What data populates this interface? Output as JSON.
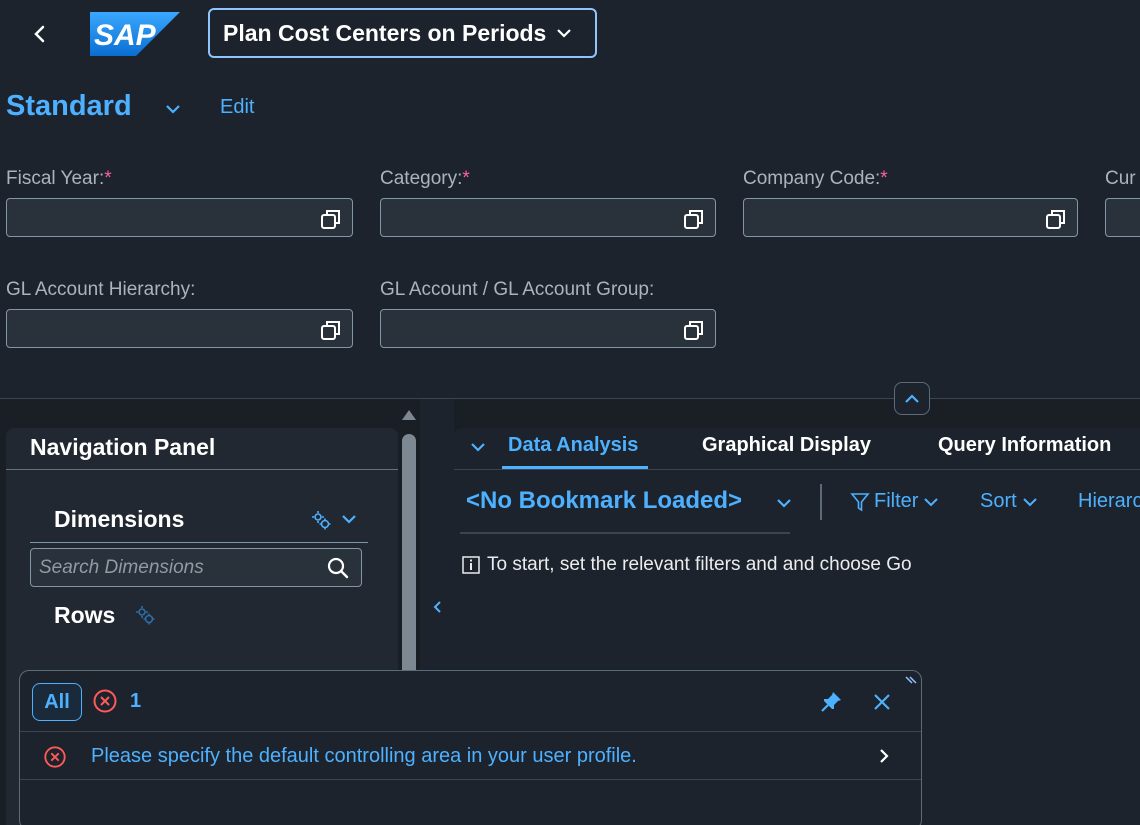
{
  "shell": {
    "logo_text": "SAP",
    "app_title": "Plan Cost Centers on Periods"
  },
  "variant": {
    "name": "Standard",
    "edit_label": "Edit"
  },
  "filters": {
    "fiscal_year": {
      "label": "Fiscal Year:",
      "required": "*",
      "value": ""
    },
    "category": {
      "label": "Category:",
      "required": "*",
      "value": ""
    },
    "company_code": {
      "label": "Company Code:",
      "required": "*",
      "value": ""
    },
    "currency_partial": {
      "label": "Cur"
    },
    "gl_account_hierarchy": {
      "label": "GL Account Hierarchy:",
      "value": ""
    },
    "gl_account_group": {
      "label": "GL Account / GL Account Group:",
      "value": ""
    }
  },
  "navigation_panel": {
    "title": "Navigation Panel",
    "dimensions_title": "Dimensions",
    "search_placeholder": "Search Dimensions",
    "rows_title": "Rows"
  },
  "content": {
    "tabs": [
      {
        "label": "Data Analysis",
        "active": true
      },
      {
        "label": "Graphical Display",
        "active": false
      },
      {
        "label": "Query Information",
        "active": false
      }
    ],
    "bookmark": "<No Bookmark Loaded>",
    "toolbar": {
      "filter_label": "Filter",
      "sort_label": "Sort",
      "hierarchy_label": "Hierarc"
    },
    "info_message": "To start, set the relevant filters and and choose Go"
  },
  "message_popover": {
    "all_label": "All",
    "error_count": "1",
    "messages": [
      {
        "type": "error",
        "text": "Please specify the default controlling area in your user profile."
      }
    ]
  },
  "colors": {
    "background": "#1d232c",
    "accent": "#4db1ff",
    "error": "#ff5a5a",
    "required": "#ff5fa0"
  }
}
